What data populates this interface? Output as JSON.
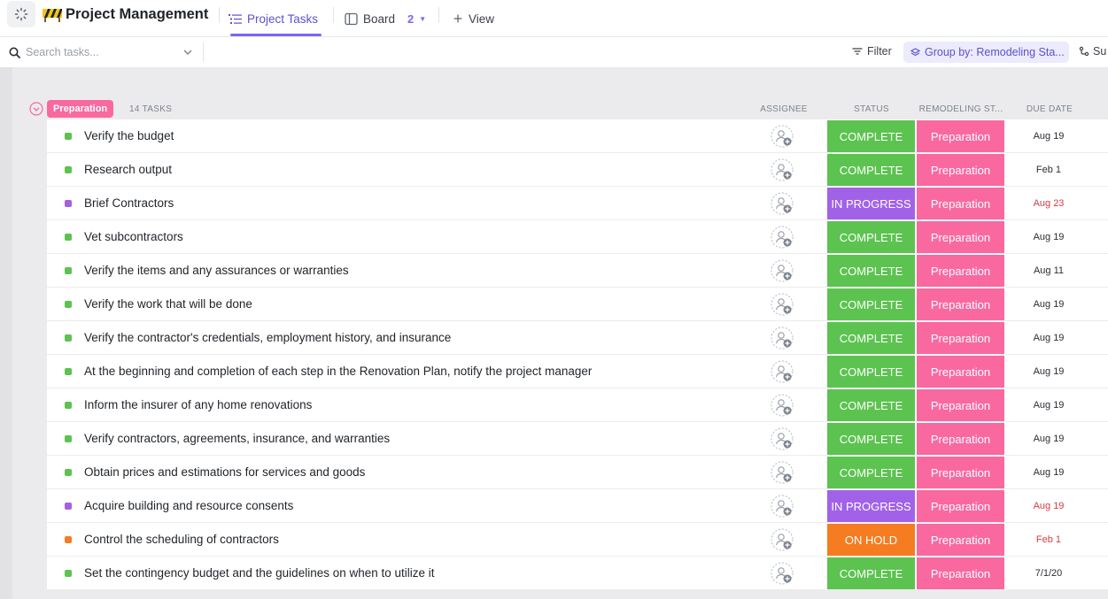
{
  "header": {
    "title": "Project Management",
    "tabs": [
      {
        "label": "Project Tasks"
      },
      {
        "label": "Board",
        "count": "2"
      },
      {
        "label": "View"
      }
    ]
  },
  "toolbar": {
    "search_placeholder": "Search tasks...",
    "filter_label": "Filter",
    "group_label": "Group by: Remodeling Sta...",
    "sub_label": "Su"
  },
  "group": {
    "name": "Preparation",
    "task_count": "14 TASKS",
    "columns": [
      "ASSIGNEE",
      "STATUS",
      "REMODELING ST...",
      "DUE DATE"
    ]
  },
  "colors": {
    "accent": "#7b68ee",
    "complete": "#5cc350",
    "in_progress": "#a262e8",
    "on_hold": "#f67c21",
    "preparation": "#f9699f",
    "overdue": "#d33d44"
  },
  "icons": {
    "collapse": "chevron-down-circle-icon",
    "assignee": "add-assignee-icon",
    "search": "search-icon",
    "filter": "filter-icon"
  },
  "tasks": [
    {
      "name": "Verify the budget",
      "status": "COMPLETE",
      "stage": "Preparation",
      "due": "Aug 19",
      "overdue": false
    },
    {
      "name": "Research output",
      "status": "COMPLETE",
      "stage": "Preparation",
      "due": "Feb 1",
      "overdue": false
    },
    {
      "name": "Brief Contractors",
      "status": "IN PROGRESS",
      "stage": "Preparation",
      "due": "Aug 23",
      "overdue": true
    },
    {
      "name": "Vet subcontractors",
      "status": "COMPLETE",
      "stage": "Preparation",
      "due": "Aug 19",
      "overdue": false
    },
    {
      "name": "Verify the items and any assurances or warranties",
      "status": "COMPLETE",
      "stage": "Preparation",
      "due": "Aug 11",
      "overdue": false
    },
    {
      "name": "Verify the work that will be done",
      "status": "COMPLETE",
      "stage": "Preparation",
      "due": "Aug 19",
      "overdue": false
    },
    {
      "name": "Verify the contractor's credentials, employment history, and insurance",
      "status": "COMPLETE",
      "stage": "Preparation",
      "due": "Aug 19",
      "overdue": false
    },
    {
      "name": "At the beginning and completion of each step in the Renovation Plan, notify the project manager",
      "status": "COMPLETE",
      "stage": "Preparation",
      "due": "Aug 19",
      "overdue": false
    },
    {
      "name": "Inform the insurer of any home renovations",
      "status": "COMPLETE",
      "stage": "Preparation",
      "due": "Aug 19",
      "overdue": false
    },
    {
      "name": "Verify contractors, agreements, insurance, and warranties",
      "status": "COMPLETE",
      "stage": "Preparation",
      "due": "Aug 19",
      "overdue": false
    },
    {
      "name": "Obtain prices and estimations for services and goods",
      "status": "COMPLETE",
      "stage": "Preparation",
      "due": "Aug 19",
      "overdue": false
    },
    {
      "name": "Acquire building and resource consents",
      "status": "IN PROGRESS",
      "stage": "Preparation",
      "due": "Aug 19",
      "overdue": true
    },
    {
      "name": "Control the scheduling of contractors",
      "status": "ON HOLD",
      "stage": "Preparation",
      "due": "Feb 1",
      "overdue": true
    },
    {
      "name": "Set the contingency budget and the guidelines on when to utilize it",
      "status": "COMPLETE",
      "stage": "Preparation",
      "due": "7/1/20",
      "overdue": false
    }
  ]
}
